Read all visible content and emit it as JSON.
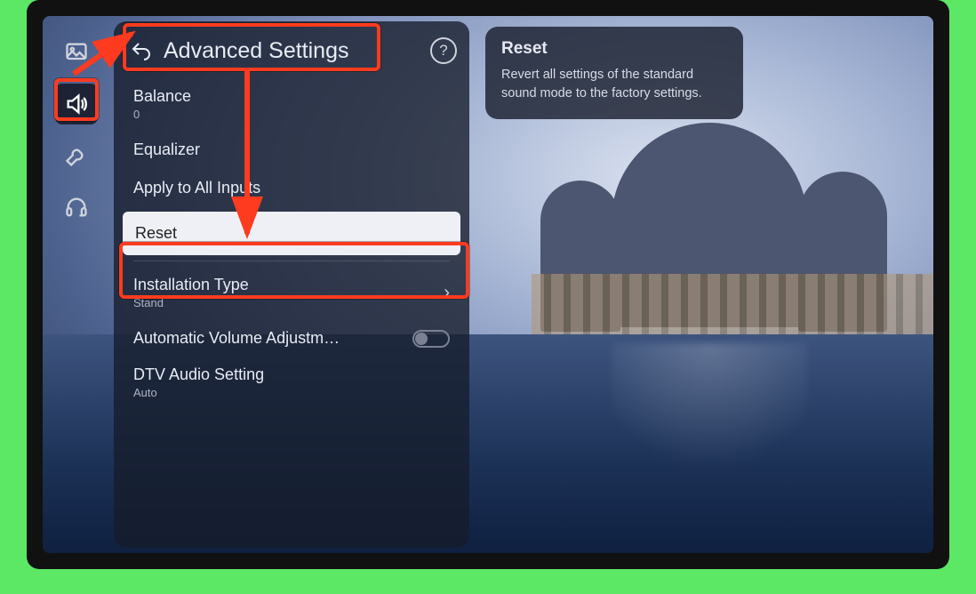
{
  "sidebar": {
    "items": [
      {
        "name": "picture"
      },
      {
        "name": "sound"
      },
      {
        "name": "general"
      },
      {
        "name": "support"
      }
    ],
    "active_index": 1
  },
  "panel": {
    "title": "Advanced Settings",
    "items": {
      "balance": {
        "label": "Balance",
        "value": "0"
      },
      "equalizer": {
        "label": "Equalizer"
      },
      "apply_all": {
        "label": "Apply to All Inputs"
      },
      "reset": {
        "label": "Reset"
      },
      "install": {
        "label": "Installation Type",
        "value": "Stand"
      },
      "auto_vol": {
        "label": "Automatic Volume Adjustm…",
        "on": false
      },
      "dtv": {
        "label": "DTV Audio Setting",
        "value": "Auto"
      }
    }
  },
  "tooltip": {
    "title": "Reset",
    "body": "Revert all settings of the standard sound mode to the factory settings."
  }
}
